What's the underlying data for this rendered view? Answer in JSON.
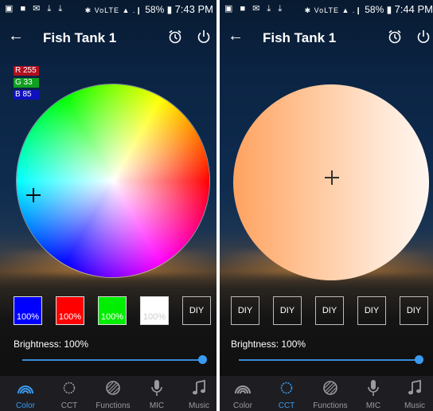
{
  "status_bar": {
    "left": "▣ ■ ✉ ⤓ ⤓",
    "icons_right": "✱ VoLTE ▲ .❙",
    "battery": "58%",
    "battery_icon": "battery-icon"
  },
  "screens": [
    {
      "time": "7:43 PM",
      "title": "Fish Tank 1",
      "rgb": {
        "r_label": "R 255",
        "g_label": "G 33",
        "b_label": "B 85",
        "r_color": "#b01020",
        "g_color": "#10a020",
        "b_color": "#1010c0"
      },
      "swatches": [
        {
          "label": "100%",
          "color": "#0000ff"
        },
        {
          "label": "100%",
          "color": "#ff0000"
        },
        {
          "label": "100%",
          "color": "#00ee00"
        },
        {
          "label": "100%",
          "color": "#ffffff"
        },
        {
          "label": "DIY",
          "color": ""
        }
      ],
      "brightness": "Brightness: 100%",
      "brightness_value": 1.0
    },
    {
      "time": "7:44 PM",
      "title": "Fish Tank 1",
      "swatches": [
        {
          "label": "DIY"
        },
        {
          "label": "DIY"
        },
        {
          "label": "DIY"
        },
        {
          "label": "DIY"
        },
        {
          "label": "DIY"
        }
      ],
      "brightness": "Brightness: 100%",
      "brightness_value": 1.0
    }
  ],
  "tabs": [
    {
      "label": "Color",
      "icon": "rainbow-icon"
    },
    {
      "label": "CCT",
      "icon": "sun-icon"
    },
    {
      "label": "Functions",
      "icon": "functions-icon"
    },
    {
      "label": "MIC",
      "icon": "microphone-icon"
    },
    {
      "label": "Music",
      "icon": "music-note-icon"
    }
  ],
  "colors": {
    "accent": "#3a9af0",
    "tab_bar": "#1e1e22",
    "inactive": "#9a9aa0"
  },
  "active_tab": {
    "left": "Color",
    "right": "CCT"
  }
}
